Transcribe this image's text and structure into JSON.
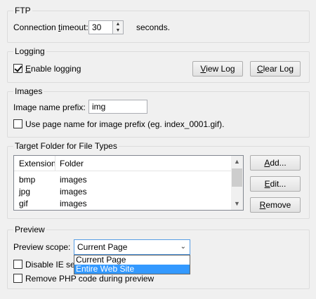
{
  "ftp": {
    "title": "FTP",
    "timeout_label_pre": "Connection ",
    "timeout_label_u": "t",
    "timeout_label_post": "imeout:",
    "timeout_value": "30",
    "timeout_unit": "seconds."
  },
  "logging": {
    "title": "Logging",
    "enable_pre": "",
    "enable_u": "E",
    "enable_post": "nable logging",
    "enable_checked": true,
    "view_u": "V",
    "view_post": "iew Log",
    "clear_u": "C",
    "clear_post": "lear Log"
  },
  "images": {
    "title": "Images",
    "prefix_label": "Image name prefix:",
    "prefix_value": "img",
    "use_page_name_label": "Use page name for image prefix (eg. index_0001.gif)."
  },
  "target": {
    "title": "Target Folder for File Types",
    "columns": [
      "Extension",
      "Folder"
    ],
    "rows": [
      {
        "ext": "bmp",
        "folder": "images"
      },
      {
        "ext": "jpg",
        "folder": "images"
      },
      {
        "ext": "gif",
        "folder": "images"
      }
    ],
    "add_u": "A",
    "add_post": "dd...",
    "edit_u": "E",
    "edit_post": "dit...",
    "remove_u": "R",
    "remove_post": "emove"
  },
  "preview": {
    "title": "Preview",
    "scope_label": "Preview scope:",
    "scope_value": "Current Page",
    "scope_options": [
      "Current Page",
      "Entire Web Site"
    ],
    "disable_ie_label": "Disable IE secu",
    "remove_php_label": "Remove PHP code during preview"
  }
}
